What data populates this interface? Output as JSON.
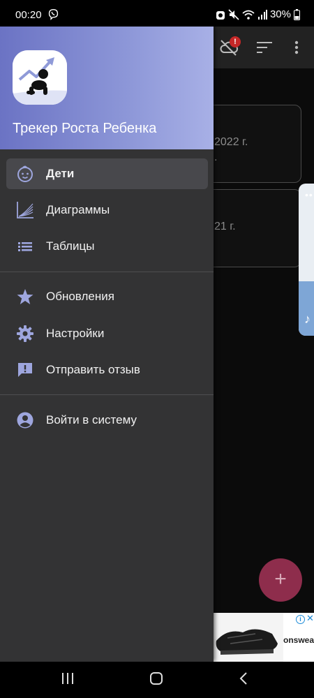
{
  "status_bar": {
    "time": "00:20",
    "battery": "30%"
  },
  "drawer": {
    "app_title": "Трекер Роста Ребенка",
    "items": [
      {
        "label": "Дети",
        "icon": "baby-face-icon",
        "selected": true
      },
      {
        "label": "Диаграммы",
        "icon": "growth-chart-icon",
        "selected": false
      },
      {
        "label": "Таблицы",
        "icon": "list-icon",
        "selected": false
      },
      {
        "label": "Обновления",
        "icon": "star-icon",
        "selected": false
      },
      {
        "label": "Настройки",
        "icon": "gear-icon",
        "selected": false
      },
      {
        "label": "Отправить отзыв",
        "icon": "feedback-icon",
        "selected": false
      },
      {
        "label": "Войти в систему",
        "icon": "account-circle-icon",
        "selected": false
      }
    ]
  },
  "background_app": {
    "cards": [
      {
        "date": "2022 г.",
        "sub": "."
      },
      {
        "date": "21 г.",
        "sub": ""
      }
    ],
    "fab_label": "+",
    "ad_brand": "onswear.",
    "notification_badge": "!"
  },
  "colors": {
    "accent": "#7f86d0",
    "drawer_bg": "#333334",
    "fab": "#8e2d4c"
  }
}
